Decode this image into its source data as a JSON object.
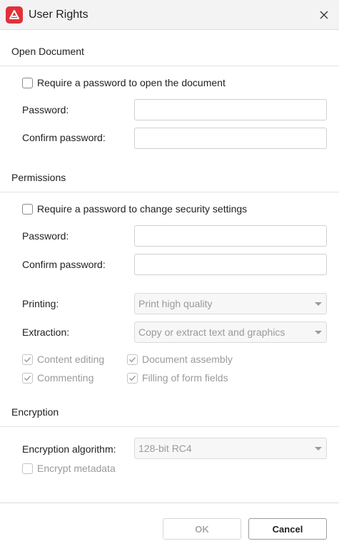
{
  "window": {
    "title": "User Rights"
  },
  "open_document": {
    "section_title": "Open Document",
    "require_password_label": "Require a password to open the document",
    "require_password_checked": false,
    "password_label": "Password:",
    "password_value": "",
    "confirm_label": "Confirm password:",
    "confirm_value": ""
  },
  "permissions": {
    "section_title": "Permissions",
    "require_password_label": "Require a password to change security settings",
    "require_password_checked": false,
    "password_label": "Password:",
    "password_value": "",
    "confirm_label": "Confirm password:",
    "confirm_value": "",
    "printing_label": "Printing:",
    "printing_value": "Print high quality",
    "extraction_label": "Extraction:",
    "extraction_value": "Copy or extract text and graphics",
    "options": {
      "content_editing": {
        "label": "Content editing",
        "checked": true,
        "enabled": false
      },
      "document_assembly": {
        "label": "Document assembly",
        "checked": true,
        "enabled": false
      },
      "commenting": {
        "label": "Commenting",
        "checked": true,
        "enabled": false
      },
      "filling_form_fields": {
        "label": "Filling of form fields",
        "checked": true,
        "enabled": false
      }
    }
  },
  "encryption": {
    "section_title": "Encryption",
    "algorithm_label": "Encryption algorithm:",
    "algorithm_value": "128-bit RC4",
    "encrypt_metadata_label": "Encrypt metadata",
    "encrypt_metadata_checked": false
  },
  "footer": {
    "ok_label": "OK",
    "cancel_label": "Cancel"
  },
  "colors": {
    "app_icon": "#e0313a",
    "disabled_text": "#9a9a9a"
  }
}
